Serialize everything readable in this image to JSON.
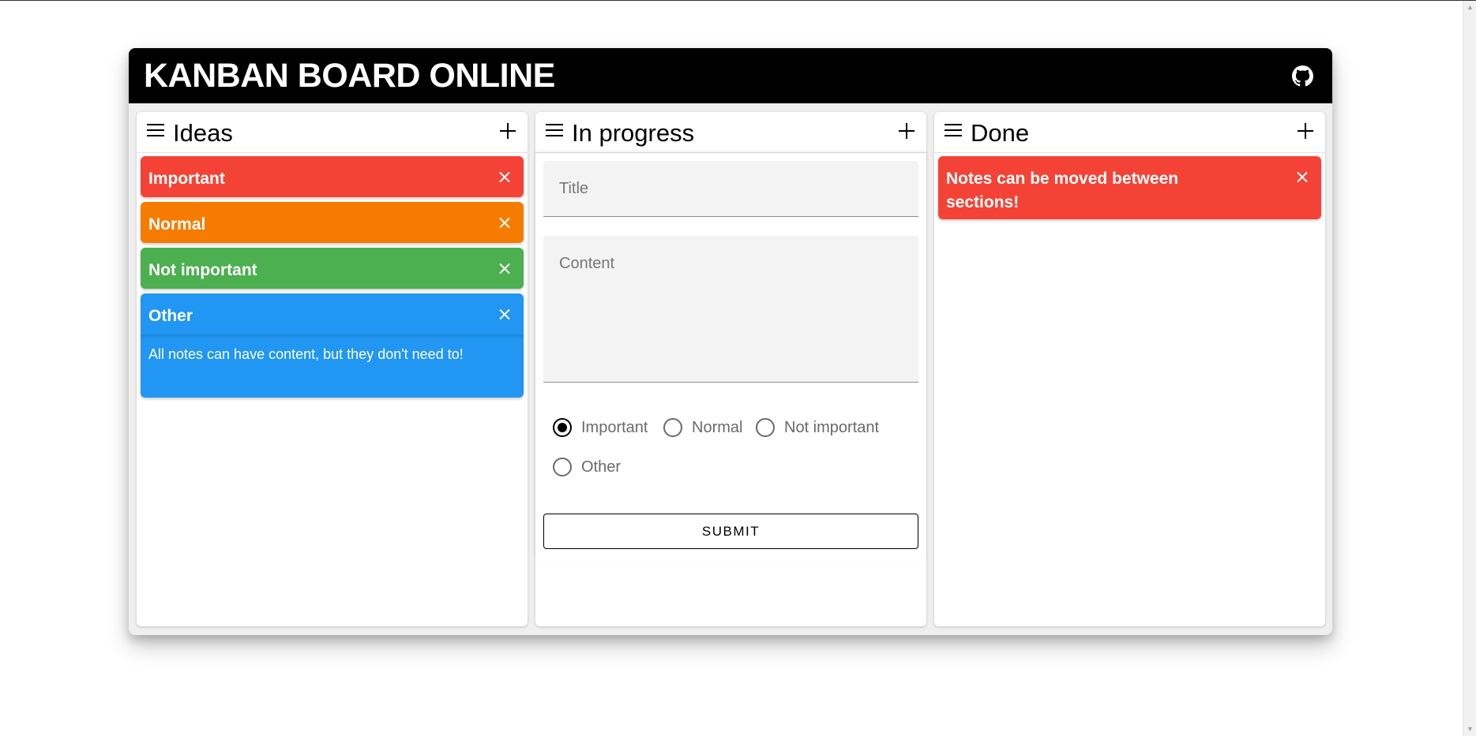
{
  "app": {
    "title": "KANBAN BOARD ONLINE",
    "github_icon": "github-icon"
  },
  "colors": {
    "important": "#f44336",
    "normal": "#f57c00",
    "not_important": "#4caf50",
    "other": "#2196f3",
    "header": "#000000"
  },
  "columns": [
    {
      "title": "Ideas",
      "notes": [
        {
          "title": "Important",
          "priority": "important"
        },
        {
          "title": "Normal",
          "priority": "normal"
        },
        {
          "title": "Not important",
          "priority": "not_important"
        },
        {
          "title": "Other",
          "priority": "other",
          "content": "All notes can have content, but they don't need to!"
        }
      ]
    },
    {
      "title": "In progress",
      "form": {
        "title_placeholder": "Title",
        "content_placeholder": "Content",
        "options": [
          "Important",
          "Normal",
          "Not important",
          "Other"
        ],
        "selected": "Important",
        "submit_label": "SUBMIT"
      }
    },
    {
      "title": "Done",
      "notes": [
        {
          "title": "Notes can be moved between sections!",
          "priority": "important"
        }
      ]
    }
  ]
}
